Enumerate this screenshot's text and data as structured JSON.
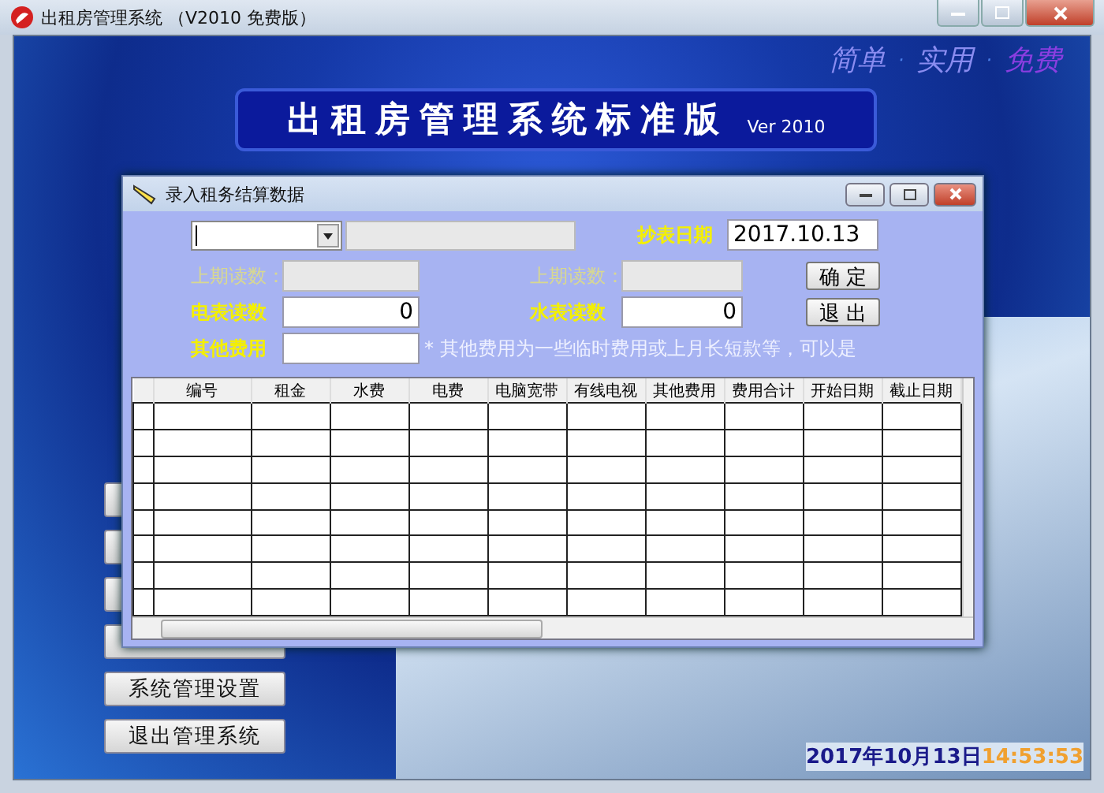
{
  "window": {
    "title": "出租房管理系统 （V2010 免费版）"
  },
  "slogan": {
    "separator": "·",
    "items": [
      {
        "text": "简单",
        "color": "#8a8cf0"
      },
      {
        "text": "实用",
        "color": "#8a8cf0"
      },
      {
        "text": "免费",
        "color": "#8a3ee0"
      }
    ]
  },
  "banner": {
    "title": "出租房管理系统标准版",
    "version": "Ver 2010"
  },
  "side_buttons": [
    "系统管理设置",
    "退出管理系统"
  ],
  "dialog": {
    "title": "录入租务结算数据",
    "room_info": {
      "disabled": true
    },
    "date": {
      "label": "抄表日期",
      "value": "2017.10.13"
    },
    "prev_electric": {
      "label": "上期读数：",
      "disabled": true
    },
    "prev_water": {
      "label": "上期读数：",
      "disabled": true
    },
    "electric": {
      "label": "电表读数",
      "value": "0",
      "disabled": false
    },
    "water": {
      "label": "水表读数",
      "value": "0",
      "disabled": false
    },
    "other": {
      "label": "其他费用",
      "disabled": false
    },
    "note": "* 其他费用为一些临时费用或上月长短款等，可以是",
    "buttons": [
      "确 定",
      "退 出"
    ],
    "table": {
      "columns": [
        "编号",
        "租金",
        "水费",
        "电费",
        "电脑宽带",
        "有线电视",
        "其他费用",
        "费用合计",
        "开始日期",
        "截止日期"
      ]
    }
  },
  "status_bar": {
    "date": "2017年10月13日",
    "time": "14:53:53"
  }
}
